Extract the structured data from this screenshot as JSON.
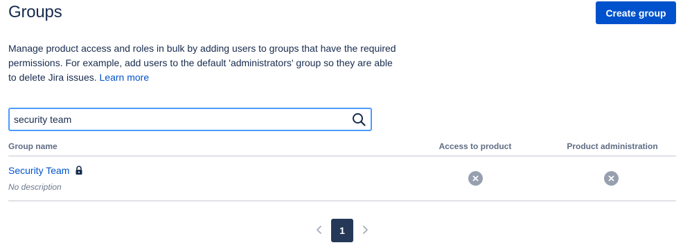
{
  "page": {
    "title": "Groups",
    "create_button_label": "Create group"
  },
  "description": {
    "text": "Manage product access and roles in bulk by adding users to groups that have the required permissions. For example, add users to the default 'administrators' group so they are able to delete Jira issues.",
    "link_label": "Learn more"
  },
  "search": {
    "value": "security team",
    "icon": "search-icon"
  },
  "table": {
    "columns": [
      "Group name",
      "Access to product",
      "Product administration"
    ],
    "rows": [
      {
        "name": "Security Team",
        "locked": true,
        "description": "No description",
        "access_to_product": "none",
        "product_administration": "none"
      }
    ]
  },
  "pagination": {
    "current_page": "1",
    "prev_icon": "chevron-left-icon",
    "next_icon": "chevron-right-icon"
  },
  "colors": {
    "primary": "#0052CC",
    "text": "#172B4D",
    "subtle": "#5E6C84",
    "focus_border": "#4C9AFF",
    "badge_grey": "#97A0AF",
    "pager_active": "#253858"
  }
}
